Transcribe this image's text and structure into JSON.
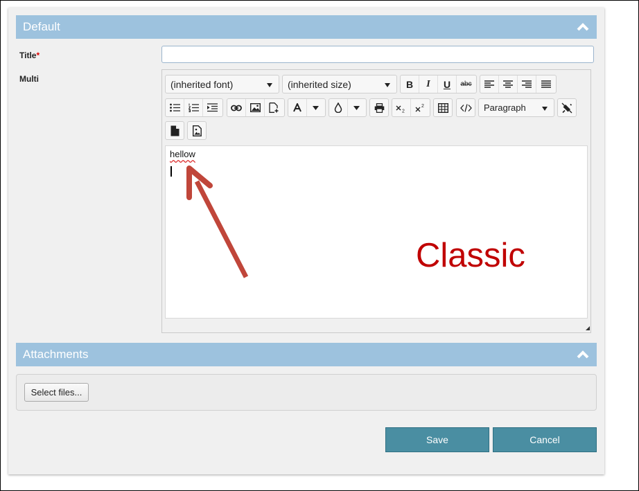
{
  "sections": {
    "default": {
      "title": "Default"
    },
    "attachments": {
      "title": "Attachments",
      "select_files_label": "Select files..."
    }
  },
  "form": {
    "title_label": "Title",
    "required_marker": "*",
    "title_value": "",
    "multi_label": "Multi"
  },
  "toolbar": {
    "font_family": "(inherited font)",
    "font_size": "(inherited size)",
    "block_format": "Paragraph",
    "bold_glyph": "B",
    "italic_glyph": "I",
    "underline_glyph": "U",
    "strike_glyph": "abc"
  },
  "editor": {
    "content_text": "hellow"
  },
  "annotation": {
    "text": "Classic",
    "color": "#c00000"
  },
  "actions": {
    "save_label": "Save",
    "cancel_label": "Cancel"
  },
  "colors": {
    "header_bg": "#9dc2de",
    "button_bg": "#4a8ea2",
    "arrow": "#c0463a"
  }
}
